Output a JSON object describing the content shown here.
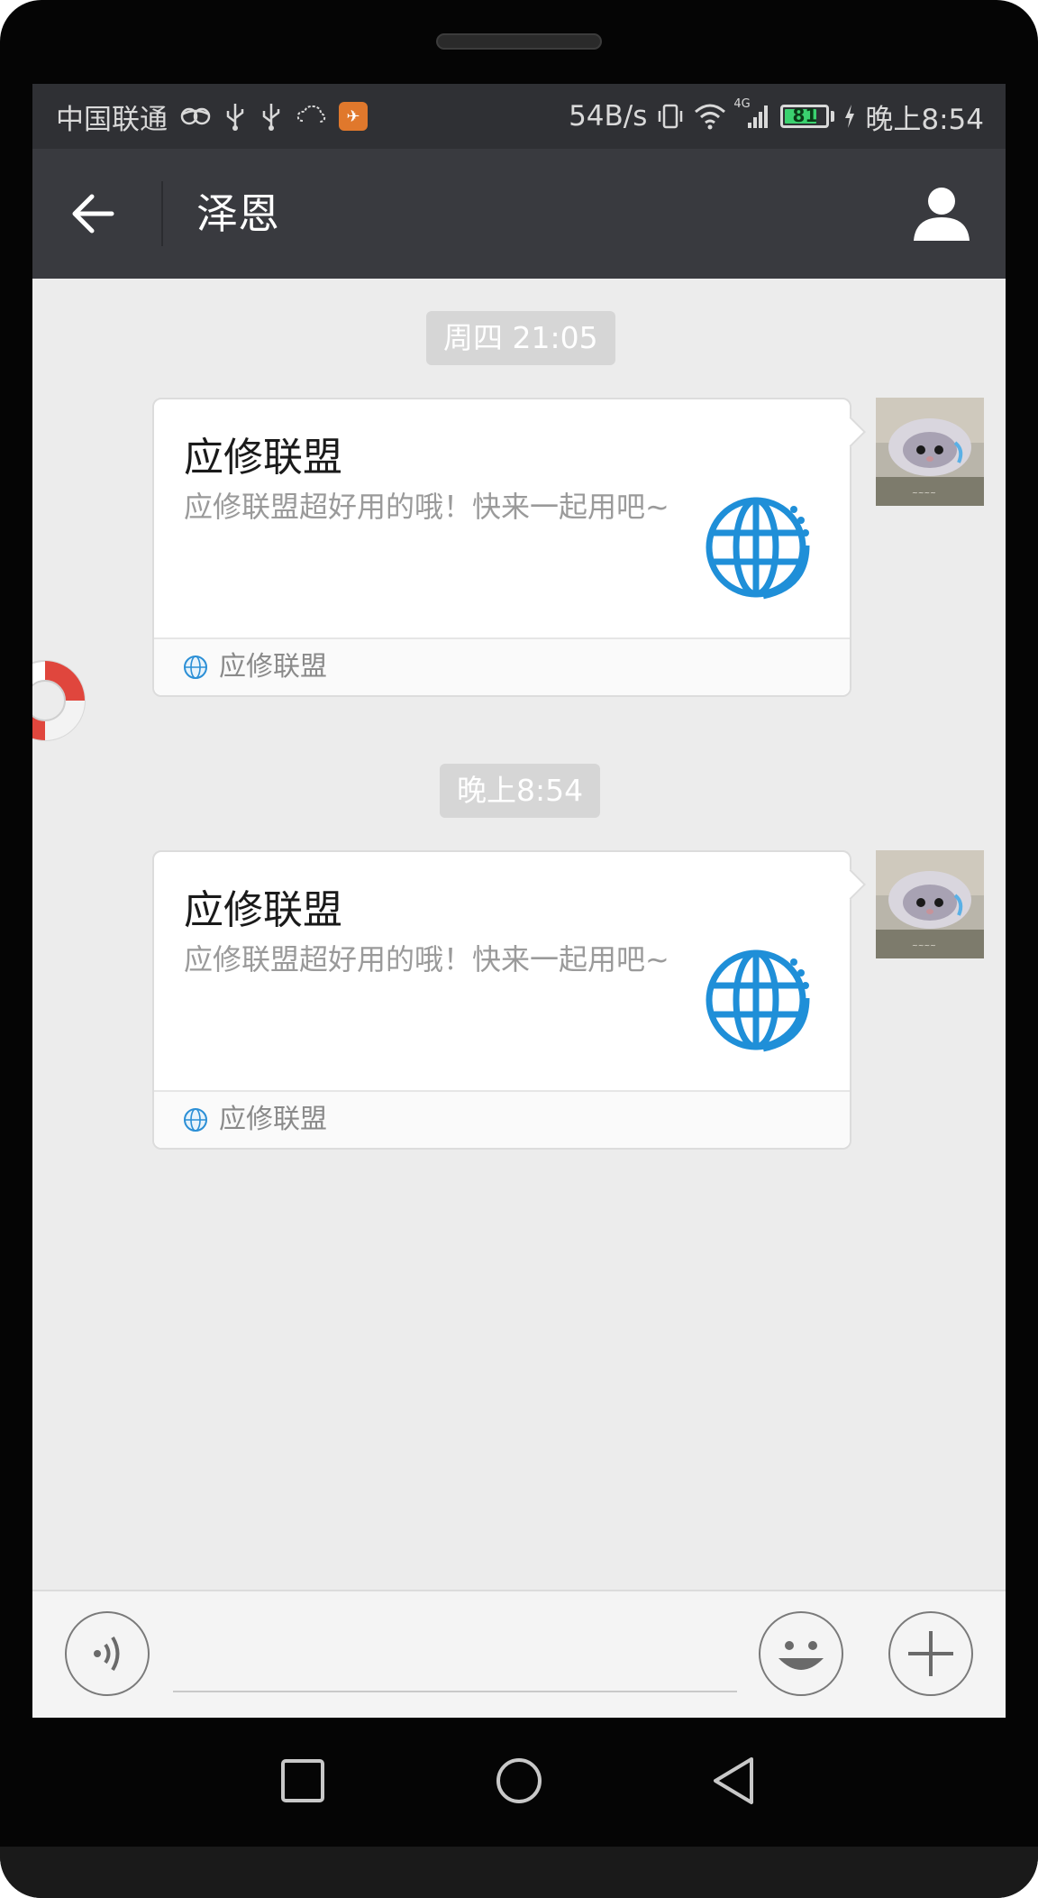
{
  "status_bar": {
    "carrier": "中国联通",
    "net_speed": "54B/s",
    "network": "4G",
    "battery_level": "81",
    "battery_fraction": 0.81,
    "time": "晚上8:54",
    "icons": [
      "glasses-icon",
      "usb-icon",
      "usb-icon",
      "weather-icon",
      "app-notification-icon",
      "vibrate-icon",
      "wifi-icon",
      "signal-icon",
      "battery-icon",
      "charging-icon"
    ]
  },
  "header": {
    "title": "泽恩",
    "back_icon": "arrow-left-icon",
    "contact_icon": "person-icon"
  },
  "messages": [
    {
      "timestamp": "周四 21:05",
      "card": {
        "title": "应修联盟",
        "description": "应修联盟超好用的哦！快来一起用吧~",
        "source": "应修联盟",
        "thumb_icon": "globe-icon"
      }
    },
    {
      "timestamp": "晚上8:54",
      "card": {
        "title": "应修联盟",
        "description": "应修联盟超好用的哦！快来一起用吧~",
        "source": "应修联盟",
        "thumb_icon": "globe-icon"
      }
    }
  ],
  "input_bar": {
    "voice_icon": "voice-icon",
    "text_value": "",
    "emoji_icon": "smiley-icon",
    "more_icon": "plus-icon"
  },
  "nav_bar": {
    "icons": [
      "square-recent-icon",
      "circle-home-icon",
      "triangle-back-icon"
    ]
  },
  "colors": {
    "title_bar": "#393a3f",
    "status_bar": "#2f3034",
    "chat_background": "#ececec",
    "globe_blue": "#1f8fd8",
    "battery_green": "#3bd16f"
  }
}
